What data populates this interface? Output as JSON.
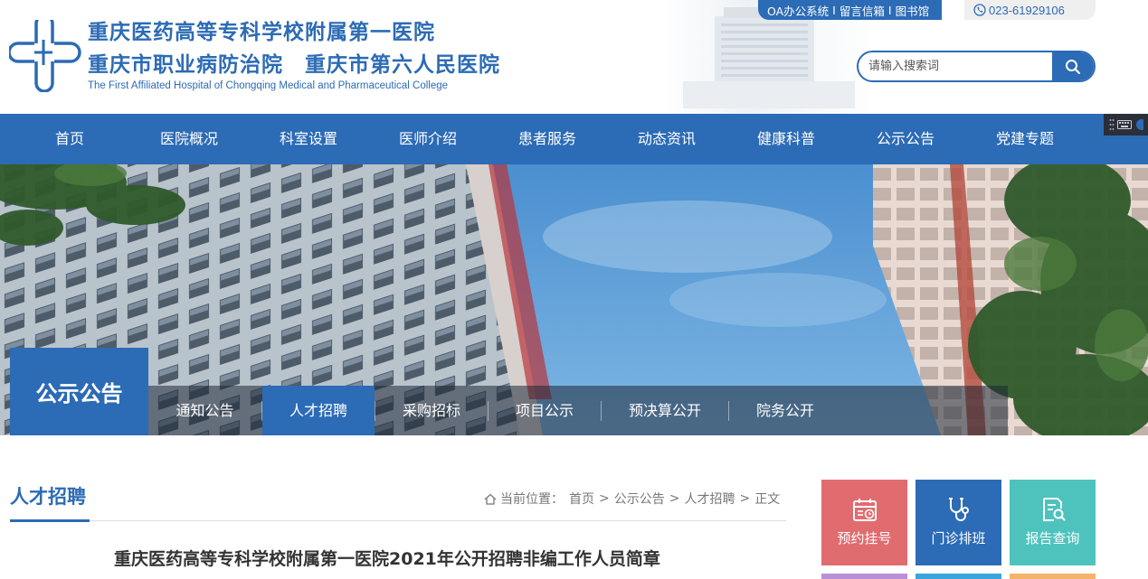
{
  "header": {
    "name_cn_line1": "重庆医药高等专科学校附属第一医院",
    "name_cn_line2": "重庆市职业病防治院　重庆市第六人民医院",
    "name_en": "The First Affiliated Hospital of Chongqing Medical and Pharmaceutical College",
    "top_links": [
      "OA办公系统",
      "留言信箱",
      "图书馆"
    ],
    "top_link_separator": "I",
    "phone": "023-61929106",
    "search_placeholder": "请输入搜索词"
  },
  "nav": {
    "items": [
      "首页",
      "医院概况",
      "科室设置",
      "医师介绍",
      "患者服务",
      "动态资讯",
      "健康科普",
      "公示公告",
      "党建专题"
    ]
  },
  "banner": {
    "section_title": "公示公告",
    "subnav": [
      {
        "label": "通知公告",
        "active": false
      },
      {
        "label": "人才招聘",
        "active": true
      },
      {
        "label": "采购招标",
        "active": false
      },
      {
        "label": "项目公示",
        "active": false
      },
      {
        "label": "预决算公开",
        "active": false
      },
      {
        "label": "院务公开",
        "active": false
      }
    ]
  },
  "content": {
    "title": "人才招聘",
    "breadcrumb_prefix": "当前位置：",
    "breadcrumb": [
      "首页",
      "公示公告",
      "人才招聘",
      "正文"
    ],
    "breadcrumb_separator": ">",
    "article_title": "重庆医药高等专科学校附属第一医院2021年公开招聘非编工作人员简章"
  },
  "quick_tiles": [
    {
      "label": "预约挂号",
      "icon": "calendar-icon",
      "color": "#e06c70"
    },
    {
      "label": "门诊排班",
      "icon": "stethoscope-icon",
      "color": "#2c6bb5"
    },
    {
      "label": "报告查询",
      "icon": "report-search-icon",
      "color": "#4ec3bd"
    }
  ],
  "quick_tiles_row2_colors": [
    "#b98fd8",
    "#3aa5dc",
    "#f4b36b"
  ],
  "colors": {
    "brand_blue": "#2c6bb5",
    "sky": "#4a9ad6"
  }
}
